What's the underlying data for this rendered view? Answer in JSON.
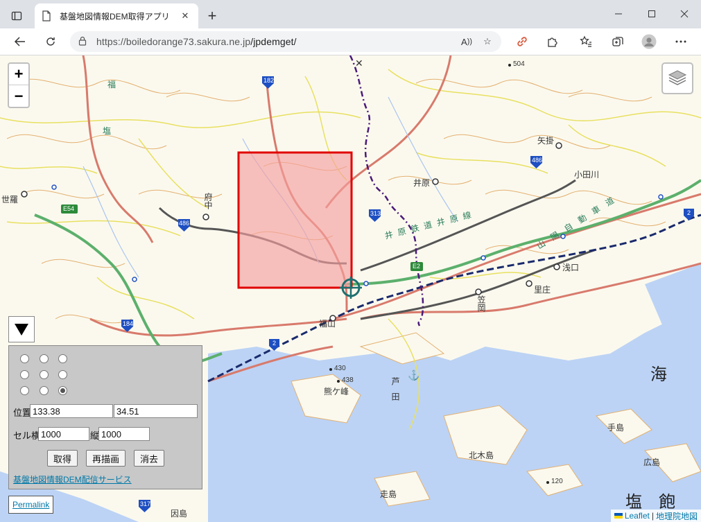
{
  "browser": {
    "tab_title": "基盤地図情報DEM取得アプリ",
    "url_host": "https://boiledorange73.sakura.ne.jp",
    "url_path": "/jpdemget/"
  },
  "map": {
    "labels": {
      "fuchu": "府中",
      "ihara": "井原",
      "yakake": "矢掛",
      "odagawa": "小田川",
      "fukuyama": "福山",
      "kasaoka": "笠岡",
      "asakuchi": "浅口",
      "satosho": "里庄",
      "sera": "世羅",
      "kumagamine": "熊ケ峰",
      "kitagi": "北木島",
      "teshima": "手島",
      "hiroshima": "広島",
      "toshima": "走島",
      "innoshima": "因島",
      "ashida": "芦田",
      "sea_kai": "海",
      "sea_shiwaku": "塩　飽",
      "line_ibara": "井 原 鉄 道 井 原 線",
      "sanyo_exp": "山 陽 自 動 車 道",
      "fukuen": "福",
      "shiodai": "塩",
      "route_182": "182",
      "route_486a": "486",
      "route_486b": "486",
      "route_313": "313",
      "route_184": "184",
      "route_2a": "2",
      "route_2b": "2",
      "route_317": "317",
      "e54": "E54",
      "e2": "E2",
      "elev_504": "504",
      "elev_430": "430",
      "elev_438": "438",
      "elev_120": "120"
    },
    "zoom_in": "+",
    "zoom_out": "−"
  },
  "panel": {
    "radios": [
      false,
      false,
      false,
      false,
      false,
      false,
      false,
      false,
      true
    ],
    "pos_label": "位置",
    "lon": "133.38",
    "lat": "34.51",
    "cell_label": "セル横",
    "cell_w": "1000",
    "vert_label": "縦",
    "cell_h": "1000",
    "btn_get": "取得",
    "btn_redraw": "再描画",
    "btn_clear": "消去",
    "service_link": "基盤地図情報DEM配信サービス"
  },
  "permalink": "Permalink",
  "attribution": {
    "leaflet": "Leaflet",
    "sep": "|",
    "gsi": "地理院地図"
  },
  "colors": {
    "selection_fill": "#f5a0a0",
    "selection_stroke": "#e00000",
    "sea": "#bcd3f5",
    "land": "#fbf9ee",
    "contour": "#e3b070",
    "road_major": "#d87a6c",
    "road_minor": "#e8e060",
    "expressway": "#5cb06c"
  }
}
